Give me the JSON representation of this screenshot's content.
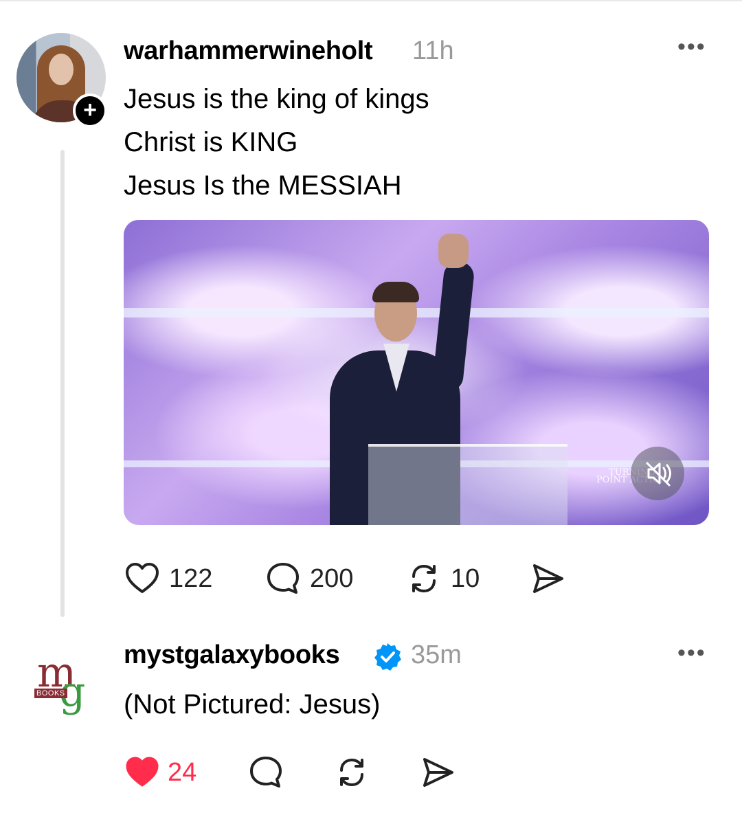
{
  "post1": {
    "username": "warhammerwineholt",
    "time": "11h",
    "more_label": "•••",
    "follow_label": "+",
    "lines": [
      "Jesus is the king of kings",
      "Christ is KING",
      "Jesus Is the MESSIAH"
    ],
    "media": {
      "watermark_line1": "TURNING",
      "watermark_line2": "POINT ACTION",
      "muted": true
    },
    "counts": {
      "likes": "122",
      "replies": "200",
      "reposts": "10"
    }
  },
  "post2": {
    "username": "mystgalaxybooks",
    "verified": true,
    "time": "35m",
    "more_label": "•••",
    "avatar": {
      "logo_m": "m",
      "logo_g": "g",
      "logo_books": "BOOKS"
    },
    "text": "(Not Pictured: Jesus)",
    "counts": {
      "likes": "24"
    },
    "liked": true
  },
  "colors": {
    "like_active": "#ff2d4b",
    "verified": "#0095f6",
    "muted_text": "#999999"
  },
  "icons": [
    "heart-icon",
    "comment-icon",
    "repost-icon",
    "share-icon",
    "mute-icon",
    "more-icon",
    "verified-icon"
  ]
}
